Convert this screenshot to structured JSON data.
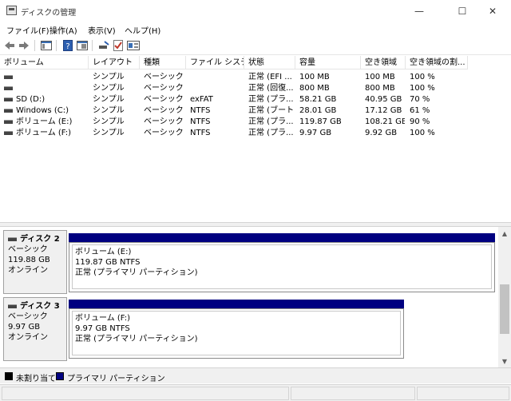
{
  "window": {
    "title": "ディスクの管理",
    "minimize_glyph": "—",
    "maximize_glyph": "☐",
    "close_glyph": "✕"
  },
  "menu": {
    "file": "ファイル(F)",
    "action": "操作(A)",
    "view": "表示(V)",
    "help": "ヘルプ(H)"
  },
  "toolbar": {
    "icons": [
      "back-arrow-icon",
      "forward-arrow-icon",
      "show-hide-console-tree-icon",
      "help-icon",
      "properties-icon",
      "connect-drive-icon",
      "check-icon",
      "refresh-icon"
    ]
  },
  "volume_list": {
    "columns": [
      "ボリューム",
      "レイアウト",
      "種類",
      "ファイル システム",
      "状態",
      "容量",
      "空き領域",
      "空き領域の割..."
    ],
    "rows": [
      [
        "",
        "シンプル",
        "ベーシック",
        "",
        "正常 (EFI ...",
        "100 MB",
        "100 MB",
        "100 %"
      ],
      [
        "",
        "シンプル",
        "ベーシック",
        "",
        "正常 (回復...",
        "800 MB",
        "800 MB",
        "100 %"
      ],
      [
        "SD (D:)",
        "シンプル",
        "ベーシック",
        "exFAT",
        "正常 (プラ...",
        "58.21 GB",
        "40.95 GB",
        "70 %"
      ],
      [
        "Windows (C:)",
        "シンプル",
        "ベーシック",
        "NTFS",
        "正常 (ブート...",
        "28.01 GB",
        "17.12 GB",
        "61 %"
      ],
      [
        "ボリューム (E:)",
        "シンプル",
        "ベーシック",
        "NTFS",
        "正常 (プラ...",
        "119.87 GB",
        "108.21 GB",
        "90 %"
      ],
      [
        "ボリューム (F:)",
        "シンプル",
        "ベーシック",
        "NTFS",
        "正常 (プラ...",
        "9.97 GB",
        "9.92 GB",
        "100 %"
      ]
    ]
  },
  "disks": [
    {
      "name": "ディスク 2",
      "type": "ベーシック",
      "size": "119.88 GB",
      "status": "オンライン",
      "volume": {
        "name": "ボリューム (E:)",
        "size_fs": "119.87 GB NTFS",
        "status": "正常 (プライマリ パーティション)"
      }
    },
    {
      "name": "ディスク 3",
      "type": "ベーシック",
      "size": "9.97 GB",
      "status": "オンライン",
      "volume": {
        "name": "ボリューム (F:)",
        "size_fs": "9.97 GB NTFS",
        "status": "正常 (プライマリ パーティション)"
      }
    }
  ],
  "legend": {
    "unallocated": "未割り当て",
    "primary": "プライマリ パーティション",
    "unallocated_color": "#000000",
    "primary_color": "#000080"
  }
}
